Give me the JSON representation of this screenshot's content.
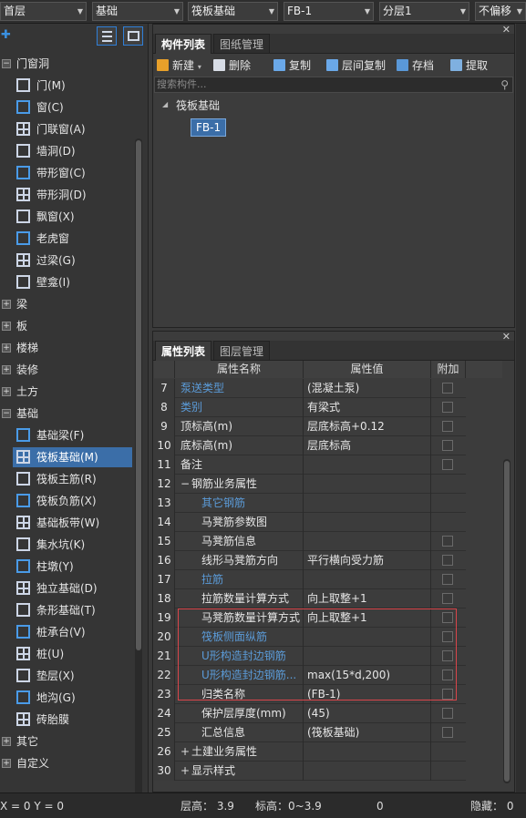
{
  "top_toolbar": {
    "floor": "首层",
    "category": "基础",
    "component_type": "筏板基础",
    "component": "FB-1",
    "layer": "分层1",
    "offset": "不偏移"
  },
  "left_tree": {
    "items": [
      {
        "label": "门窗洞",
        "level": 0,
        "expander": "−",
        "icon": "folder-icon"
      },
      {
        "label": "门(M)",
        "level": 1,
        "icon": "door-icon"
      },
      {
        "label": "窗(C)",
        "level": 1,
        "icon": "window-icon"
      },
      {
        "label": "门联窗(A)",
        "level": 1,
        "icon": "door-window-icon"
      },
      {
        "label": "墙洞(D)",
        "level": 1,
        "icon": "wall-hole-icon"
      },
      {
        "label": "带形窗(C)",
        "level": 1,
        "icon": "strip-window-icon"
      },
      {
        "label": "带形洞(D)",
        "level": 1,
        "icon": "strip-hole-icon"
      },
      {
        "label": "飘窗(X)",
        "level": 1,
        "icon": "bay-window-icon"
      },
      {
        "label": "老虎窗",
        "level": 1,
        "icon": "dormer-icon"
      },
      {
        "label": "过梁(G)",
        "level": 1,
        "icon": "lintel-icon"
      },
      {
        "label": "壁龛(I)",
        "level": 1,
        "icon": "niche-icon"
      },
      {
        "label": "梁",
        "level": 0,
        "expander": "+"
      },
      {
        "label": "板",
        "level": 0,
        "expander": "+"
      },
      {
        "label": "楼梯",
        "level": 0,
        "expander": "+"
      },
      {
        "label": "装修",
        "level": 0,
        "expander": "+"
      },
      {
        "label": "土方",
        "level": 0,
        "expander": "+"
      },
      {
        "label": "基础",
        "level": 0,
        "expander": "−"
      },
      {
        "label": "基础梁(F)",
        "level": 1,
        "icon": "foundation-beam-icon"
      },
      {
        "label": "筏板基础(M)",
        "level": 1,
        "icon": "raft-foundation-icon",
        "selected": true
      },
      {
        "label": "筏板主筋(R)",
        "level": 1,
        "icon": "raft-main-rebar-icon"
      },
      {
        "label": "筏板负筋(X)",
        "level": 1,
        "icon": "raft-negative-rebar-icon"
      },
      {
        "label": "基础板带(W)",
        "level": 1,
        "icon": "foundation-strip-icon"
      },
      {
        "label": "集水坑(K)",
        "level": 1,
        "icon": "sump-pit-icon"
      },
      {
        "label": "柱墩(Y)",
        "level": 1,
        "icon": "column-pier-icon"
      },
      {
        "label": "独立基础(D)",
        "level": 1,
        "icon": "isolated-footing-icon"
      },
      {
        "label": "条形基础(T)",
        "level": 1,
        "icon": "strip-footing-icon"
      },
      {
        "label": "桩承台(V)",
        "level": 1,
        "icon": "pile-cap-icon"
      },
      {
        "label": "桩(U)",
        "level": 1,
        "icon": "pile-icon"
      },
      {
        "label": "垫层(X)",
        "level": 1,
        "icon": "cushion-icon"
      },
      {
        "label": "地沟(G)",
        "level": 1,
        "icon": "trench-icon"
      },
      {
        "label": "砖胎膜",
        "level": 1,
        "icon": "brick-mold-icon"
      },
      {
        "label": "其它",
        "level": 0,
        "expander": "+"
      },
      {
        "label": "自定义",
        "level": 0,
        "expander": "+"
      }
    ]
  },
  "component_panel": {
    "tabs": [
      "构件列表",
      "图纸管理"
    ],
    "toolbar": [
      "新建",
      "删除",
      "复制",
      "层间复制",
      "存档",
      "提取"
    ],
    "search_placeholder": "搜索构件...",
    "tree_root": "筏板基础",
    "tree_leaf": "FB-1"
  },
  "property_panel": {
    "tabs": [
      "属性列表",
      "图层管理"
    ],
    "headers": {
      "name": "属性名称",
      "value": "属性值",
      "extra": "附加"
    },
    "rows": [
      {
        "num": "7",
        "name": "泵送类型",
        "value": "(混凝土泵)",
        "blue": true,
        "indent": 0,
        "check": true
      },
      {
        "num": "8",
        "name": "类别",
        "value": "有梁式",
        "blue": true,
        "indent": 0,
        "check": true
      },
      {
        "num": "9",
        "name": "顶标高(m)",
        "value": "层底标高+0.12",
        "blue": false,
        "indent": 0,
        "check": true
      },
      {
        "num": "10",
        "name": "底标高(m)",
        "value": "层底标高",
        "blue": false,
        "indent": 0,
        "check": true
      },
      {
        "num": "11",
        "name": "备注",
        "value": "",
        "blue": false,
        "indent": 0,
        "check": true
      },
      {
        "num": "12",
        "name": "钢筋业务属性",
        "value": "",
        "blue": false,
        "indent": 0,
        "group": "−",
        "check": false
      },
      {
        "num": "13",
        "name": "其它钢筋",
        "value": "",
        "blue": true,
        "indent": 1,
        "check": false
      },
      {
        "num": "14",
        "name": "马凳筋参数图",
        "value": "",
        "blue": false,
        "indent": 1,
        "check": false
      },
      {
        "num": "15",
        "name": "马凳筋信息",
        "value": "",
        "blue": false,
        "indent": 1,
        "check": true
      },
      {
        "num": "16",
        "name": "线形马凳筋方向",
        "value": "平行横向受力筋",
        "blue": false,
        "indent": 1,
        "check": true
      },
      {
        "num": "17",
        "name": "拉筋",
        "value": "",
        "blue": true,
        "indent": 1,
        "check": true
      },
      {
        "num": "18",
        "name": "拉筋数量计算方式",
        "value": "向上取整+1",
        "blue": false,
        "indent": 1,
        "check": true
      },
      {
        "num": "19",
        "name": "马凳筋数量计算方式",
        "value": "向上取整+1",
        "blue": false,
        "indent": 1,
        "check": true
      },
      {
        "num": "20",
        "name": "筏板侧面纵筋",
        "value": "",
        "blue": true,
        "indent": 1,
        "check": true
      },
      {
        "num": "21",
        "name": "U形构造封边钢筋",
        "value": "",
        "blue": true,
        "indent": 1,
        "check": true
      },
      {
        "num": "22",
        "name": "U形构造封边钢筋...",
        "value": "max(15*d,200)",
        "blue": true,
        "indent": 1,
        "check": true
      },
      {
        "num": "23",
        "name": "归类名称",
        "value": "(FB-1)",
        "blue": false,
        "indent": 1,
        "check": true
      },
      {
        "num": "24",
        "name": "保护层厚度(mm)",
        "value": "(45)",
        "blue": false,
        "indent": 1,
        "check": true
      },
      {
        "num": "25",
        "name": "汇总信息",
        "value": "(筏板基础)",
        "blue": false,
        "indent": 1,
        "check": true
      },
      {
        "num": "26",
        "name": "土建业务属性",
        "value": "",
        "blue": false,
        "indent": 0,
        "group": "+",
        "check": false
      },
      {
        "num": "30",
        "name": "显示样式",
        "value": "",
        "blue": false,
        "indent": 0,
        "group": "+",
        "check": false
      }
    ]
  },
  "status_bar": {
    "coords": "X = 0 Y = 0",
    "floor_height": "层高： 3.9",
    "elevation": "标高：0~3.9",
    "value": "0",
    "hidden": "隐藏： 0"
  }
}
